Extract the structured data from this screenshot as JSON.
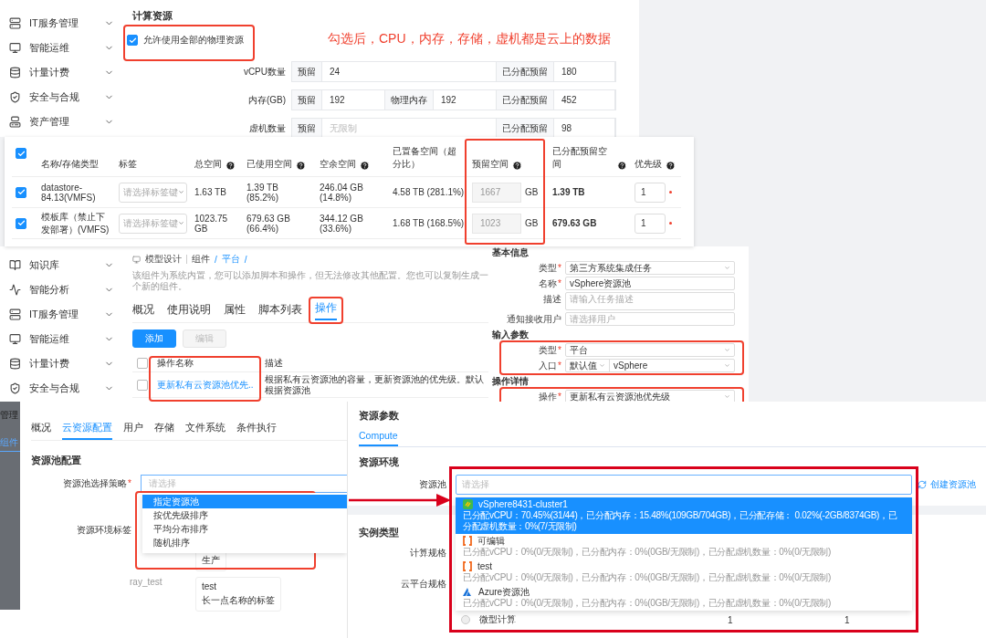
{
  "compute_panel": {
    "sidebar": [
      {
        "label": "IT服务管理",
        "kind": "service"
      },
      {
        "label": "智能运维",
        "kind": "ops"
      },
      {
        "label": "计量计费",
        "kind": "billing"
      },
      {
        "label": "安全与合规",
        "kind": "security"
      },
      {
        "label": "资产管理",
        "kind": "asset"
      }
    ],
    "heading": "计算资源",
    "allow_all": {
      "label": "允许使用全部的物理资源",
      "checked": true
    },
    "annotation": "勾选后，CPU，内存，存储，虚机都是云上的数据",
    "rows": [
      {
        "label": "vCPU数量",
        "cells": [
          {
            "label": "预留",
            "value": "24"
          },
          {
            "label": "已分配预留",
            "value": "180"
          }
        ]
      },
      {
        "label": "内存(GB)",
        "cells": [
          {
            "label": "预留",
            "value": "192"
          },
          {
            "label": "物理内存",
            "value": "192"
          },
          {
            "label": "已分配预留",
            "value": "452"
          }
        ]
      },
      {
        "label": "虚机数量",
        "cells": [
          {
            "label": "预留",
            "placeholder": "无限制"
          },
          {
            "label": "已分配预留",
            "value": "98"
          }
        ]
      }
    ]
  },
  "storage_table": {
    "all_checked": true,
    "columns": [
      {
        "label": "名称/存储类型",
        "help": false
      },
      {
        "label": "标签",
        "help": false
      },
      {
        "label": "总空间",
        "help": true
      },
      {
        "label": "已使用空间",
        "help": true
      },
      {
        "label": "空余空间",
        "help": true
      },
      {
        "label": "已置备空间（超分比）",
        "help": false
      },
      {
        "label": "预留空间",
        "help": true
      },
      {
        "label": "已分配预留空间",
        "help": true
      },
      {
        "label": "优先级",
        "help": true
      }
    ],
    "rows": [
      {
        "checked": true,
        "name": "datastore-84.13(VMFS)",
        "tag_placeholder": "请选择标签键",
        "total": "1.63 TB",
        "used": "1.39 TB (85.2%)",
        "free": "246.04 GB (14.8%)",
        "provisioned": "4.58 TB (281.1%)",
        "reserved": "1667",
        "unit": "GB",
        "allocated": "1.39 TB",
        "priority": "1"
      },
      {
        "checked": true,
        "name": "模板库（禁止下发部署）(VMFS)",
        "tag_placeholder": "请选择标签键",
        "total": "1023.75 GB",
        "used": "679.63 GB (66.4%)",
        "free": "344.12 GB (33.6%)",
        "provisioned": "1.68 TB (168.5%)",
        "reserved": "1023",
        "unit": "GB",
        "allocated": "679.63 GB",
        "priority": "1"
      }
    ]
  },
  "component_panel": {
    "sidebar": [
      {
        "label": "知识库",
        "kind": "knowledge"
      },
      {
        "label": "智能分析",
        "kind": "analysis"
      },
      {
        "label": "IT服务管理",
        "kind": "service"
      },
      {
        "label": "智能运维",
        "kind": "ops"
      },
      {
        "label": "计量计费",
        "kind": "billing"
      },
      {
        "label": "安全与合规",
        "kind": "security"
      }
    ],
    "breadcrumb": [
      {
        "label": "模型设计",
        "current": false
      },
      {
        "label": "组件",
        "current": false
      },
      {
        "label": "平台",
        "current": true
      }
    ],
    "separator": "/",
    "description": "该组件为系统内置，您可以添加脚本和操作，但无法修改其他配置。您也可以复制生成一个新的组件。",
    "tabs": [
      {
        "label": "概况",
        "selected": false
      },
      {
        "label": "使用说明",
        "selected": false
      },
      {
        "label": "属性",
        "selected": false
      },
      {
        "label": "脚本列表",
        "selected": false
      },
      {
        "label": "操作",
        "selected": true
      }
    ],
    "buttons": [
      {
        "label": "添加",
        "disabled": false
      },
      {
        "label": "编辑",
        "disabled": true
      }
    ],
    "header_checked": false,
    "columns": [
      "操作名称",
      "描述"
    ],
    "rows": [
      {
        "checked": false,
        "name": "更新私有云资源池优先..",
        "description": "根据私有云资源池的容量，更新资源池的优先级。默认根据资源池"
      }
    ]
  },
  "task_form": {
    "required_mark": "*",
    "sections": [
      {
        "title": "基本信息",
        "highlighted": false,
        "fields": [
          {
            "label": "类型",
            "required": true,
            "kind": "select",
            "value": "第三方系统集成任务"
          },
          {
            "label": "名称",
            "required": true,
            "kind": "input",
            "value": "vSphere资源池"
          },
          {
            "label": "描述",
            "required": false,
            "kind": "textarea",
            "placeholder": "请输入任务描述"
          },
          {
            "label": "通知接收用户",
            "required": false,
            "kind": "input",
            "placeholder": "请选择用户"
          }
        ]
      },
      {
        "title": "输入参数",
        "highlighted": true,
        "fields": [
          {
            "label": "类型",
            "required": true,
            "kind": "select",
            "value": "平台"
          },
          {
            "label": "入口",
            "required": true,
            "kind": "combo",
            "prefix": "默认值",
            "value": "vSphere"
          }
        ]
      },
      {
        "title": "操作详情",
        "highlighted": true,
        "fields": [
          {
            "label": "操作",
            "required": true,
            "kind": "select",
            "value": "更新私有云资源池优先级"
          }
        ]
      }
    ]
  },
  "pool_config": {
    "side_tabs": [
      {
        "label": "管理",
        "selected": false
      },
      {
        "label": "组件",
        "selected": true
      }
    ],
    "tabs": [
      {
        "label": "概况",
        "selected": false
      },
      {
        "label": "云资源配置",
        "selected": true
      },
      {
        "label": "用户",
        "selected": false
      },
      {
        "label": "存储",
        "selected": false
      },
      {
        "label": "文件系统",
        "selected": false
      },
      {
        "label": "条件执行",
        "selected": false
      }
    ],
    "section": "资源池配置",
    "strategy": {
      "label": "资源池选择策略",
      "required": true,
      "required_mark": "*",
      "placeholder": "请选择"
    },
    "options": [
      {
        "label": "指定资源池",
        "selected": true
      },
      {
        "label": "按优先级排序",
        "selected": false
      },
      {
        "label": "平均分布排序",
        "selected": false
      },
      {
        "label": "随机排序",
        "selected": false
      }
    ],
    "tags_label": "资源环境标签",
    "tags": [
      {
        "values": [
          "生产"
        ]
      },
      {
        "key": "ray_test",
        "values": [
          "test",
          "长一点名称的标签"
        ]
      }
    ]
  },
  "resource_params": {
    "title": "资源参数",
    "tabs": [
      {
        "label": "Compute",
        "selected": true
      }
    ],
    "env_title": "资源环境",
    "pool_label": "资源池",
    "pool_placeholder": "请选择",
    "create_link": "创建资源池",
    "pools": [
      {
        "kind": "vsphere",
        "name": "vSphere8431-cluster1",
        "selected": true,
        "detail": "已分配vCPU：70.45%(31/44)，已分配内存：15.48%(109GB/704GB)，已分配存储： 0.02%(-2GB/8374GB)，已分配虚机数量：0%(7/无限制)"
      },
      {
        "kind": "bracket",
        "name": "可编辑",
        "selected": false,
        "detail": "已分配vCPU：0%(0/无限制)，已分配内存：0%(0GB/无限制)，已分配虚机数量：0%(0/无限制)"
      },
      {
        "kind": "bracket",
        "name": "test",
        "selected": false,
        "detail": "已分配vCPU：0%(0/无限制)，已分配内存：0%(0GB/无限制)，已分配虚机数量：0%(0/无限制)"
      },
      {
        "kind": "azure",
        "name": "Azure资源池",
        "selected": false,
        "detail": "已分配vCPU：0%(0/无限制)，已分配内存：0%(0GB/无限制)，已分配虚机数量：0%(0/无限制)"
      }
    ],
    "instance_title": "实例类型",
    "spec_label": "计算规格",
    "cloud_spec_label": "云平台规格",
    "spec_row": {
      "selected": false,
      "name": "微型计算",
      "values": [
        "1",
        "1"
      ]
    }
  }
}
